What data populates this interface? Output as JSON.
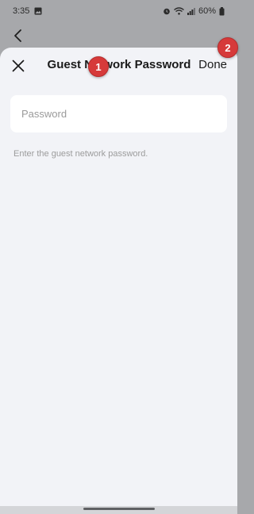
{
  "status_bar": {
    "time": "3:35",
    "battery": "60%",
    "icons": [
      "gallery-icon",
      "alarm-icon",
      "wifi-icon",
      "signal-icon",
      "battery-icon"
    ]
  },
  "header": {
    "title": "Guest Network Password",
    "done_label": "Done",
    "close_icon": "close-icon",
    "back_icon": "chevron-left-icon"
  },
  "form": {
    "password_placeholder": "Password",
    "password_value": "",
    "helper": "Enter the guest network password."
  },
  "annotations": {
    "badge_1": "1",
    "badge_2": "2",
    "badge_color": "#d63a3a"
  }
}
